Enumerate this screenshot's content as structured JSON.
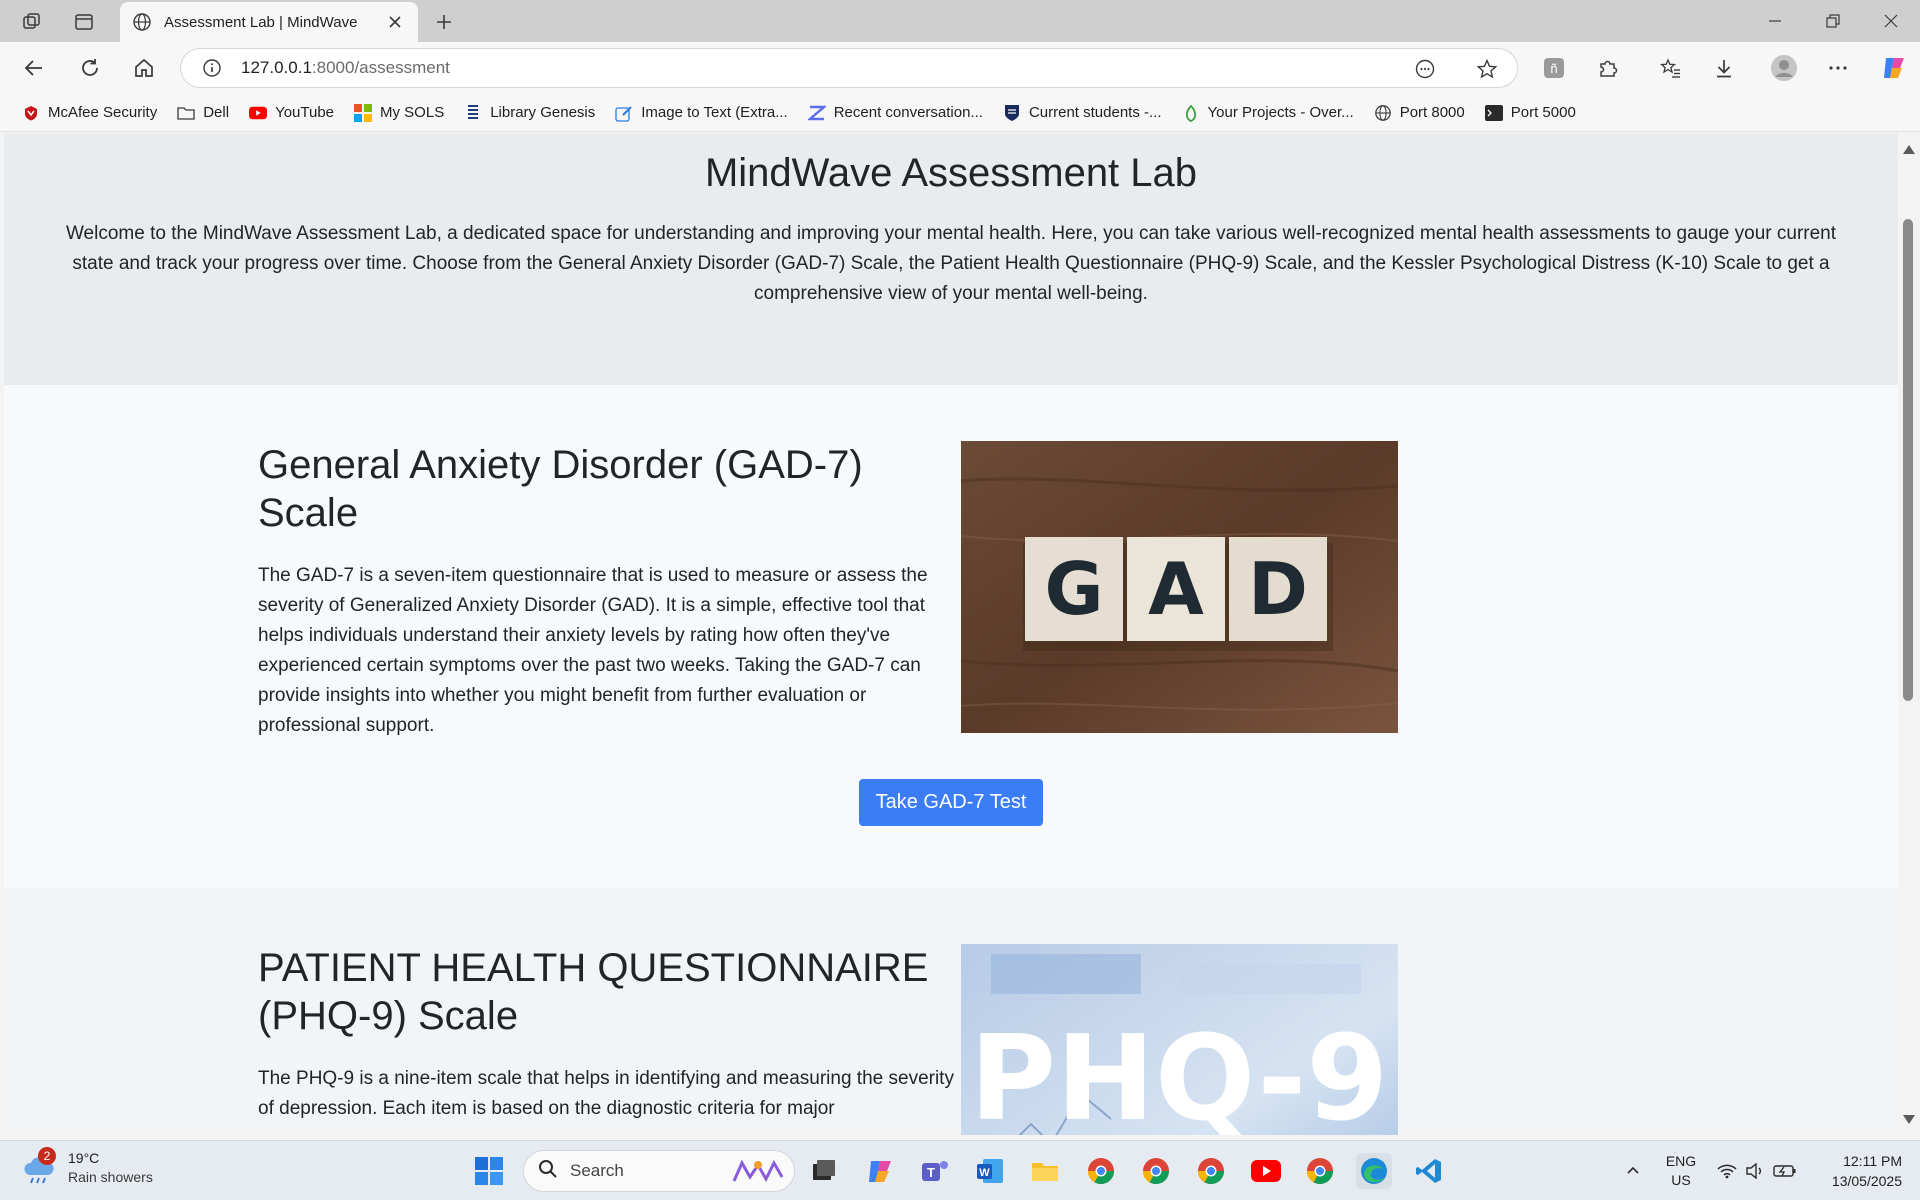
{
  "browser": {
    "tab_title": "Assessment Lab | MindWave",
    "url_host": "127.0.0.1",
    "url_rest": ":8000/assessment",
    "bookmarks": [
      {
        "label": "McAfee Security",
        "icon": "mcafee-icon",
        "color": "#c01818"
      },
      {
        "label": "Dell",
        "icon": "folder-icon",
        "color": "#3a3a3a"
      },
      {
        "label": "YouTube",
        "icon": "youtube-icon",
        "color": "#ff0000"
      },
      {
        "label": "My SOLS",
        "icon": "windows-grid-icon",
        "color": "#f25022"
      },
      {
        "label": "Library Genesis",
        "icon": "book-icon",
        "color": "#203a80"
      },
      {
        "label": "Image to Text (Extra...",
        "icon": "pencil-icon",
        "color": "#2a7be4"
      },
      {
        "label": "Recent conversation...",
        "icon": "z-logo-icon",
        "color": "#5b6cf0"
      },
      {
        "label": "Current students -...",
        "icon": "crest-icon",
        "color": "#1a2a5a"
      },
      {
        "label": "Your Projects - Over...",
        "icon": "leaf-icon",
        "color": "#3aa03a"
      },
      {
        "label": "Port 8000",
        "icon": "globe-icon",
        "color": "#3a3a3a"
      },
      {
        "label": "Port 5000",
        "icon": "terminal-icon",
        "color": "#2a2a2a"
      }
    ]
  },
  "hero": {
    "title": "MindWave Assessment Lab",
    "intro": "Welcome to the MindWave Assessment Lab, a dedicated space for understanding and improving your mental health. Here, you can take various well-recognized mental health assessments to gauge your current state and track your progress over time. Choose from the General Anxiety Disorder (GAD-7) Scale, the Patient Health Questionnaire (PHQ-9) Scale, and the Kessler Psychological Distress (K-10) Scale to get a comprehensive view of your mental well-being."
  },
  "gad": {
    "heading": "General Anxiety Disorder (GAD-7) Scale",
    "body": "The GAD-7 is a seven-item questionnaire that is used to measure or assess the severity of Generalized Anxiety Disorder (GAD). It is a simple, effective tool that helps individuals understand their anxiety levels by rating how often they've experienced certain symptoms over the past two weeks. Taking the GAD-7 can provide insights into whether you might benefit from further evaluation or professional support.",
    "image_letters": [
      "G",
      "A",
      "D"
    ],
    "button": "Take GAD-7 Test"
  },
  "phq": {
    "heading": "PATIENT HEALTH QUESTIONNAIRE (PHQ-9) Scale",
    "body": "The PHQ-9 is a nine-item scale that helps in identifying and measuring the severity of depression. Each item is based on the diagnostic criteria for major",
    "image_text": "PHQ-9"
  },
  "taskbar": {
    "weather_badge": "2",
    "temperature": "19°C",
    "condition": "Rain showers",
    "search_label": "Search",
    "lang": "ENG",
    "region": "US",
    "time": "12:11 PM",
    "date": "13/05/2025"
  },
  "colors": {
    "accent_button": "#3a7df7",
    "hero_bg": "#e9ecef",
    "page_bg": "#f8f9fa"
  }
}
